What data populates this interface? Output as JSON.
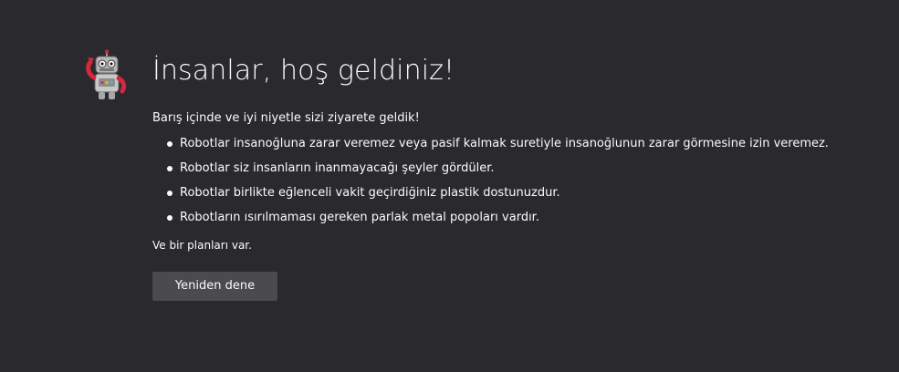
{
  "page": {
    "robot_icon": "robot-icon",
    "title": "İnsanlar, hoş geldiniz!",
    "intro": "Barış içinde ve iyi niyetle sizi ziyarete geldik!",
    "facts": [
      "Robotlar insanoğluna zarar veremez veya pasif kalmak suretiyle insanoğlunun zarar görmesine izin veremez.",
      "Robotlar siz insanların inanmayacağı şeyler gördüler.",
      "Robotlar birlikte eğlenceli vakit geçirdiğiniz plastik dostunuzdur.",
      "Robotların ısırılmaması gereken parlak metal popoları vardır."
    ],
    "plan": "Ve bir planları var.",
    "retry_label": "Yeniden dene"
  },
  "colors": {
    "background": "#2a2a2e",
    "text": "#fbfbfe",
    "button": "#4a4a4f",
    "robot_red": "#d7263d",
    "robot_metal": "#b8b8b8"
  }
}
